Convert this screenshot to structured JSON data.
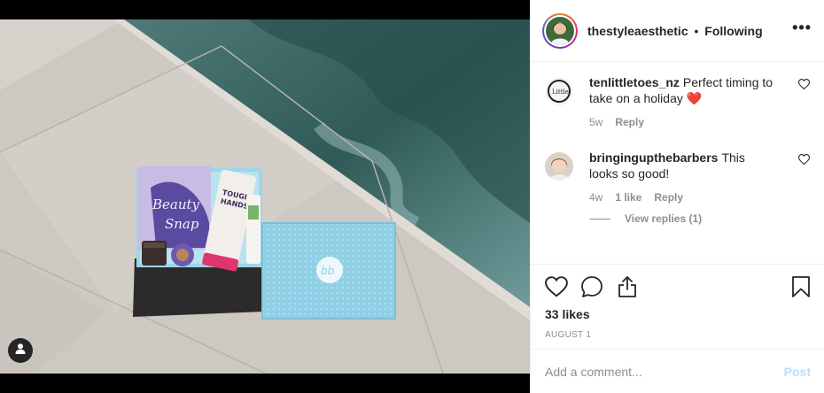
{
  "post": {
    "author": "thestyleaesthetic",
    "separator": "•",
    "follow_status": "Following",
    "more_label": "•••",
    "likes": "33 likes",
    "date": "AUGUST 1"
  },
  "photo": {
    "box_label_line1": "Beauty",
    "box_label_line2": "Snap",
    "tube_label_line1": "TOUGH",
    "tube_label_line2": "HANDS",
    "lid_logo": "bb",
    "colors": {
      "pool": "#3f6b6a",
      "concrete": "#cfcac3",
      "box": "#8fd0e6"
    }
  },
  "comments": [
    {
      "user": "tenlittletoes_nz",
      "text": "Perfect timing to take on a holiday ❤️",
      "avatar_text": "Little",
      "time": "5w",
      "likes": "",
      "reply_label": "Reply"
    },
    {
      "user": "bringingupthebarbers",
      "text": "This looks so good!",
      "time": "4w",
      "likes": "1 like",
      "reply_label": "Reply",
      "view_replies": "View replies (1)"
    }
  ],
  "add_comment": {
    "placeholder": "Add a comment...",
    "post_label": "Post"
  },
  "icons": [
    "tag-user-icon",
    "heart-icon",
    "comment-icon",
    "share-icon",
    "bookmark-icon",
    "comment-like-heart-icon"
  ]
}
